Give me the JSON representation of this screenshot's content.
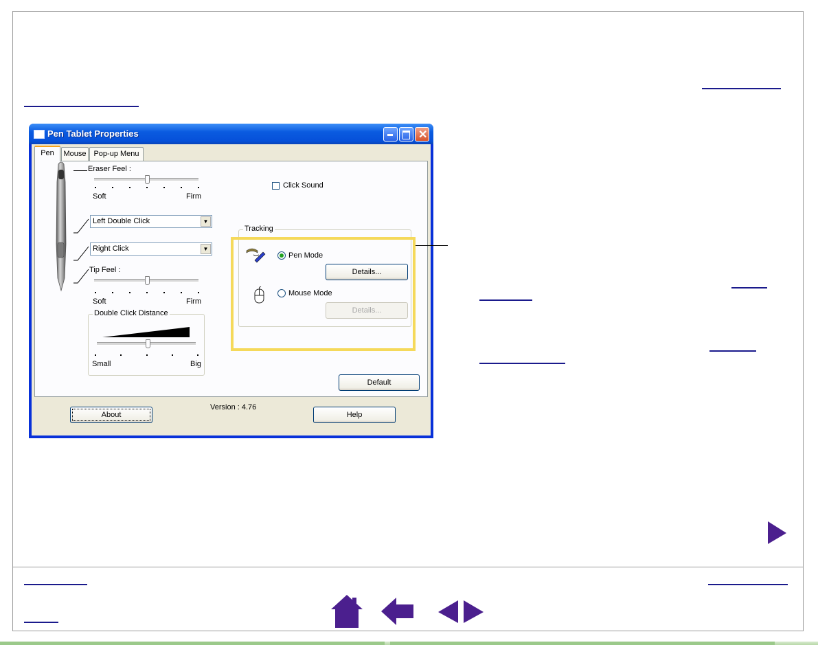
{
  "window": {
    "title": "Pen Tablet Properties",
    "tabs": [
      {
        "label": "Pen",
        "active": true
      },
      {
        "label": "Mouse",
        "active": false
      },
      {
        "label": "Pop-up Menu",
        "active": false
      }
    ],
    "eraser": {
      "label": "Eraser Feel :",
      "min_label": "Soft",
      "max_label": "Firm",
      "level": 0.5
    },
    "side_switch_upper": {
      "value": "Left Double Click"
    },
    "side_switch_lower": {
      "value": "Right Click"
    },
    "tip": {
      "label": "Tip Feel :",
      "min_label": "Soft",
      "max_label": "Firm",
      "level": 0.5
    },
    "double_click": {
      "label": "Double Click Distance",
      "min_label": "Small",
      "max_label": "Big",
      "level": 0.5
    },
    "click_sound": {
      "label": "Click Sound",
      "checked": false
    },
    "tracking": {
      "label": "Tracking",
      "pen_mode": {
        "label": "Pen Mode",
        "selected": true,
        "details_label": "Details..."
      },
      "mouse_mode": {
        "label": "Mouse Mode",
        "selected": false,
        "details_label": "Details..."
      }
    },
    "default_label": "Default",
    "about_label": "About",
    "version": "Version : 4.76",
    "help_label": "Help"
  },
  "colors": {
    "highlight": "#f5d95a",
    "nav": "#4b1f8e",
    "titlebar": "#0a5be0"
  },
  "nav": {
    "next_page": "triangle-right-icon",
    "home": "home-icon",
    "back": "arrow-left-icon",
    "prev_next": "prev-next-icon"
  }
}
